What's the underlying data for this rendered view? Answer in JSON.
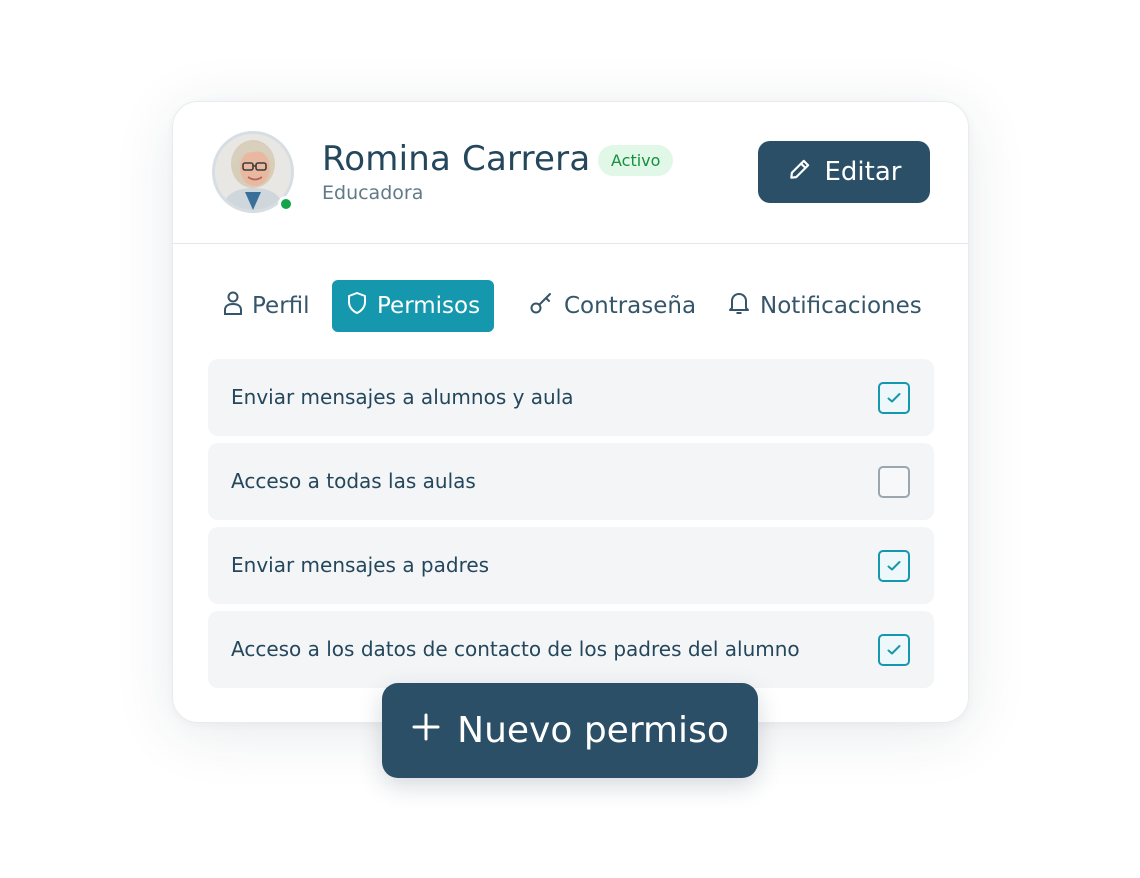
{
  "profile": {
    "name": "Romina Carrera",
    "status": "Activo",
    "role": "Educadora",
    "edit_label": "Editar"
  },
  "tabs": [
    {
      "label": "Perfil",
      "icon": "user-icon",
      "active": false
    },
    {
      "label": "Permisos",
      "icon": "shield-icon",
      "active": true
    },
    {
      "label": "Contraseña",
      "icon": "key-icon",
      "active": false
    },
    {
      "label": "Notificaciones",
      "icon": "bell-icon",
      "active": false
    }
  ],
  "permissions": [
    {
      "label": "Enviar mensajes a alumnos y aula",
      "checked": true
    },
    {
      "label": "Acceso a todas las aulas",
      "checked": false
    },
    {
      "label": "Enviar mensajes a padres",
      "checked": true
    },
    {
      "label": "Acceso a los datos de contacto de los padres del alumno",
      "checked": true
    }
  ],
  "new_permission_label": "Nuevo permiso",
  "colors": {
    "primary": "#2a4f66",
    "accent": "#1597ad",
    "status_green": "#15903d",
    "online": "#14a34a"
  }
}
